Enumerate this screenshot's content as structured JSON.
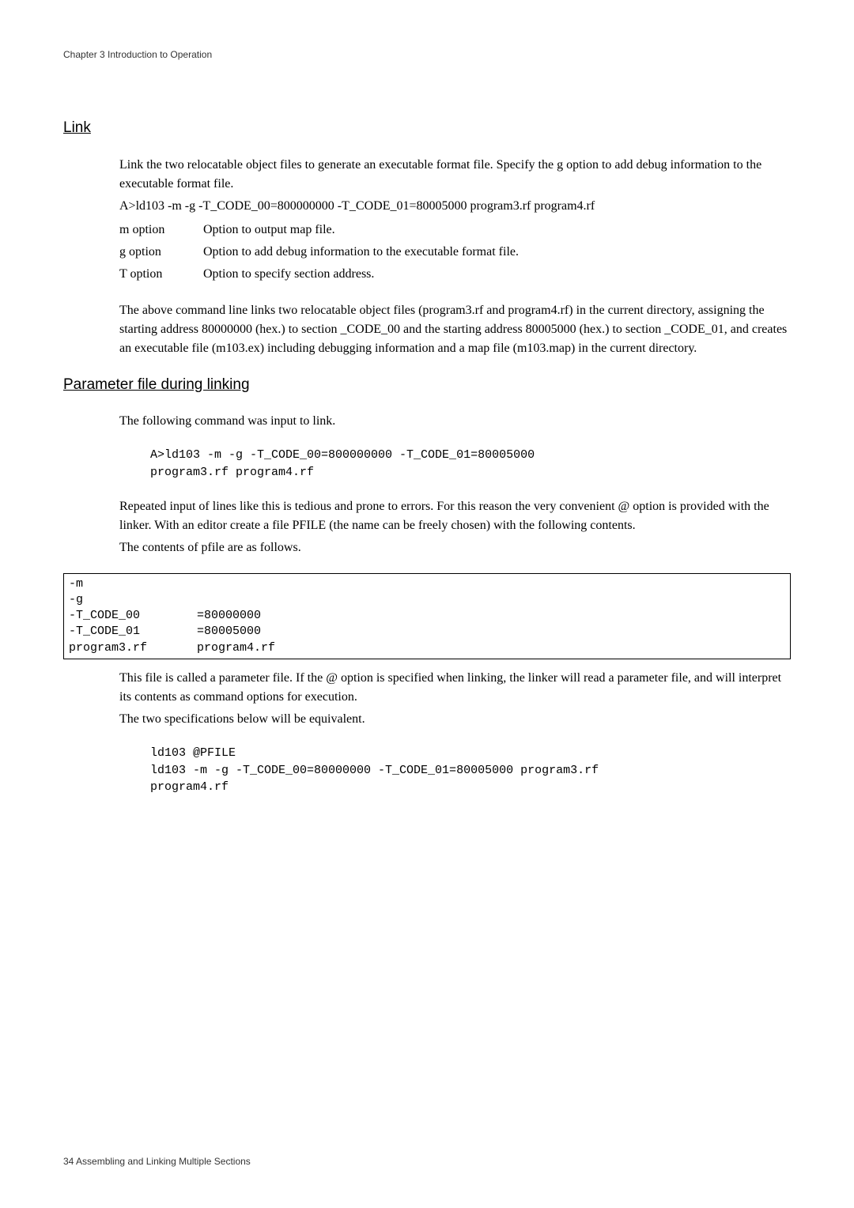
{
  "header": "Chapter  3   Introduction to Operation",
  "section1_title": "Link",
  "link_intro": "Link the two relocatable object files to generate an executable format file. Specify the g option to add debug information to the executable format file.",
  "link_cmd": "A>ld103 -m -g -T_CODE_00=800000000 -T_CODE_01=80005000 program3.rf program4.rf",
  "opts": {
    "m": {
      "name": "m option",
      "desc": "Option to output map file."
    },
    "g": {
      "name": "g option",
      "desc": "Option to add debug information to the executable format file."
    },
    "t": {
      "name": "T option",
      "desc": "Option to specify section address."
    }
  },
  "link_para2": "The above command line links two relocatable object files (program3.rf and program4.rf) in the current directory, assigning the starting address 80000000 (hex.) to section _CODE_00 and the starting address 80005000 (hex.) to section _CODE_01, and creates an executable file (m103.ex) including debugging information and a map file (m103.map) in the current directory.",
  "section2_title": "Parameter file during linking",
  "pf_intro": "The following command was input to link.",
  "pf_code1": "A>ld103 -m -g -T_CODE_00=800000000 -T_CODE_01=80005000\nprogram3.rf program4.rf",
  "pf_para2": "Repeated input of lines like this is tedious and prone to errors. For this reason the very convenient @ option is provided with the linker. With an editor create a file PFILE (the name can be freely chosen) with the following contents.",
  "pf_para3": "The contents of pfile are as follows.",
  "pfile_box": "-m\n-g\n-T_CODE_00        =80000000\n-T_CODE_01        =80005000\nprogram3.rf       program4.rf",
  "pf_para4": "This file is called a parameter file. If the @ option is specified when linking, the linker will read a parameter file, and will interpret its contents as command options for execution.",
  "pf_para5": "The two specifications below will be equivalent.",
  "pf_code2": "ld103 @PFILE\nld103 -m -g -T_CODE_00=80000000 -T_CODE_01=80005000 program3.rf\nprogram4.rf",
  "footer": "34  Assembling and Linking Multiple Sections"
}
